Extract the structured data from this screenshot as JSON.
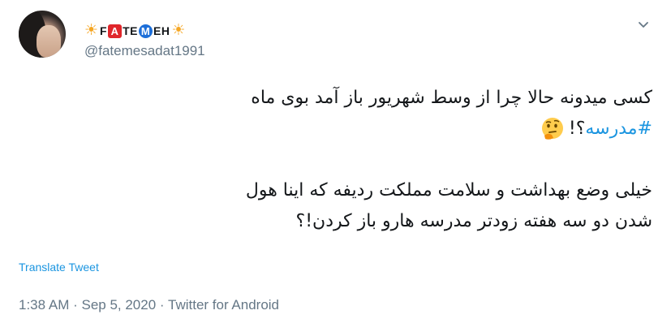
{
  "author": {
    "display_name_left_emoji": "☀",
    "display_name_parts": [
      "F",
      "A",
      "TE",
      "M",
      "EH"
    ],
    "display_name_right_emoji": "☀",
    "handle": "@fatemesadat1991"
  },
  "tweet": {
    "line1": "کسی میدونه حالا چرا از وسط شهریور باز آمد بوی ماه",
    "hashtag": "#مدرسه",
    "line2_suffix": "؟!",
    "emoji": "thinking-face-emoji",
    "para2_line1": "خیلی وضع بهداشت و سلامت مملکت ردیفه که اینا هول",
    "para2_line2": "شدن دو سه هفته زودتر مدرسه هارو باز کردن!؟"
  },
  "translate_label": "Translate Tweet",
  "meta": {
    "time": "1:38 AM",
    "sep1": " · ",
    "date": "Sep 5, 2020",
    "sep2": " · ",
    "source": "Twitter for Android"
  },
  "colors": {
    "link": "#1b95e0",
    "muted": "#657786",
    "text": "#14171a",
    "name_red": "#e0262b",
    "name_blue": "#1d6fd9",
    "sun": "#f5a623"
  },
  "icons": {
    "more": "chevron-down-icon"
  }
}
